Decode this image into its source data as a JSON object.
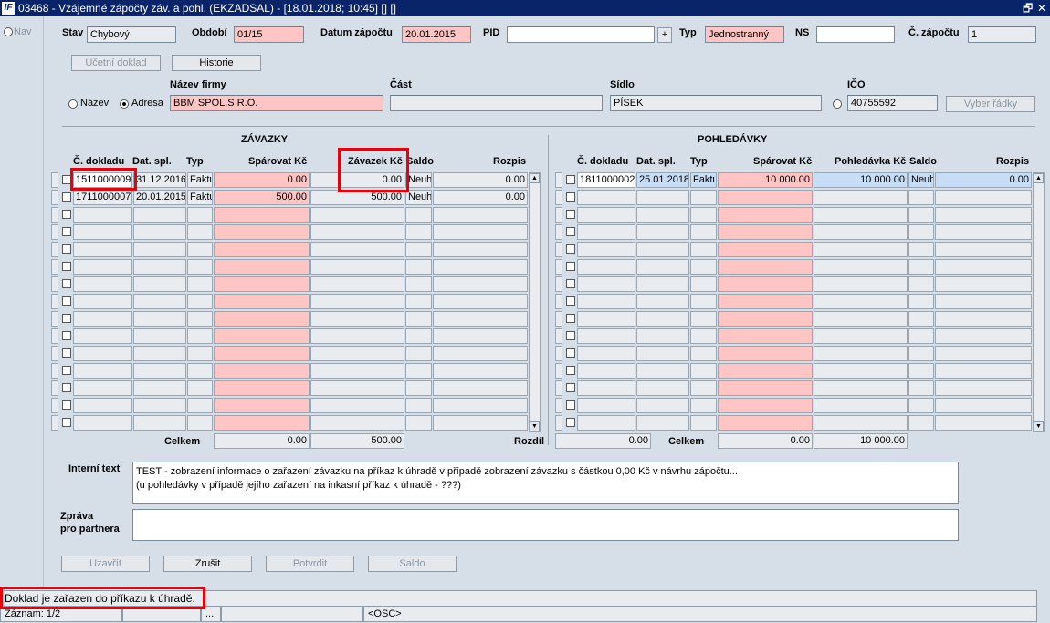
{
  "window": {
    "title": "03468 - Vzájemné zápočty záv. a pohl. (EKZADSAL) - [18.01.2018; 10:45] [] []",
    "restore_btn": "🗗",
    "close_btn": "✕"
  },
  "left_nav": {
    "label": "Nav"
  },
  "header": {
    "stav_label": "Stav",
    "stav_value": "Chybový",
    "obdobi_label": "Období",
    "obdobi_value": "01/15",
    "datum_label": "Datum zápočtu",
    "datum_value": "20.01.2015",
    "pid_label": "PID",
    "pid_value": "",
    "pid_plus": "+",
    "typ_label": "Typ",
    "typ_value": "Jednostranný",
    "ns_label": "NS",
    "ns_value": "",
    "c_zapoctu_label": "Č. zápočtu",
    "c_zapoctu_value": "1"
  },
  "buttons_top": {
    "ucetni_doklad": "Účetní doklad",
    "historie": "Historie"
  },
  "firm": {
    "nazev_firmy_label": "Název firmy",
    "cast_label": "Část",
    "sidlo_label": "Sídlo",
    "ico_label": "IČO",
    "radio_nazev": "Název",
    "radio_adresa": "Adresa",
    "nazev_value": "BBM SPOL.S R.O.",
    "cast_value": "",
    "sidlo_value": "PÍSEK",
    "ico_value": "40755592",
    "vyber_radky": "Vyber řádky"
  },
  "zavazky": {
    "title": "ZÁVAZKY",
    "columns": [
      "Č. dokladu",
      "Dat. spl.",
      "Typ",
      "Spárovat Kč",
      "Závazek Kč",
      "Saldo",
      "Rozpis"
    ],
    "rows": [
      {
        "doklad": "1511000009",
        "dat": "31.12.2016",
        "typ": "Faktu",
        "sparovat": "0.00",
        "zavazek": "0.00",
        "saldo": "Neuh",
        "rozpis": "0.00"
      },
      {
        "doklad": "1711000007",
        "dat": "20.01.2015",
        "typ": "Faktu",
        "sparovat": "500.00",
        "zavazek": "500.00",
        "saldo": "Neuh",
        "rozpis": "0.00"
      }
    ],
    "celkem_label": "Celkem",
    "celkem_sparovat": "0.00",
    "celkem_zavazek": "500.00"
  },
  "pohledavky": {
    "title": "POHLEDÁVKY",
    "columns": [
      "Č. dokladu",
      "Dat. spl.",
      "Typ",
      "Spárovat Kč",
      "Pohledávka Kč",
      "Saldo",
      "Rozpis"
    ],
    "rows": [
      {
        "doklad": "1811000002",
        "dat": "25.01.2018",
        "typ": "Faktu",
        "sparovat": "10 000.00",
        "pohledavka": "10 000.00",
        "saldo": "Neuh",
        "rozpis": "0.00"
      }
    ],
    "rozdil_label": "Rozdíl",
    "rozdil_value": "0.00",
    "celkem_label": "Celkem",
    "celkem_sparovat": "0.00",
    "celkem_pohledavka": "10 000.00"
  },
  "interni_text": {
    "label": "Interní text",
    "line1": "TEST - zobrazení informace o zařazení závazku na příkaz k úhradě v případě zobrazení závazku s částkou 0,00 Kč v návrhu zápočtu...",
    "line2": "(u pohledávky v případě jejího zařazení na inkasní příkaz k úhradě - ???)"
  },
  "zprava": {
    "label1": "Zpráva",
    "label2": "pro partnera",
    "value": ""
  },
  "buttons_bottom": {
    "uzavrit": "Uzavřít",
    "zrusit": "Zrušit",
    "potvrdit": "Potvrdit",
    "saldo": "Saldo"
  },
  "status": {
    "message": "Doklad je zařazen do příkazu k úhradě.",
    "zaznam": "Záznam: 1/2",
    "dots": "...",
    "osc": "<OSC>"
  }
}
